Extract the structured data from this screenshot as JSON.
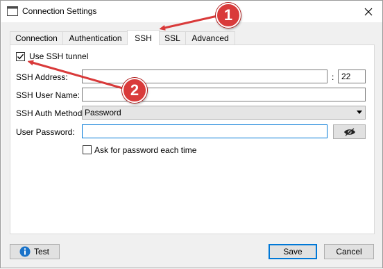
{
  "window": {
    "title": "Connection Settings"
  },
  "tabs": [
    {
      "label": "Connection"
    },
    {
      "label": "Authentication"
    },
    {
      "label": "SSH"
    },
    {
      "label": "SSL"
    },
    {
      "label": "Advanced"
    }
  ],
  "ssh": {
    "use_tunnel_label": "Use SSH tunnel",
    "use_tunnel_checked": true,
    "address_label": "SSH Address:",
    "address_value": "",
    "port_separator": ":",
    "port_value": "22",
    "username_label": "SSH User Name:",
    "username_value": "",
    "auth_method_label": "SSH Auth Method:",
    "auth_method_value": "Password",
    "password_label": "User Password:",
    "password_value": "",
    "ask_password_label": "Ask for password each time",
    "ask_password_checked": false
  },
  "buttons": {
    "test": "Test",
    "save": "Save",
    "cancel": "Cancel"
  },
  "annotations": {
    "badge1": "1",
    "badge2": "2",
    "color": "#d93a3a"
  }
}
